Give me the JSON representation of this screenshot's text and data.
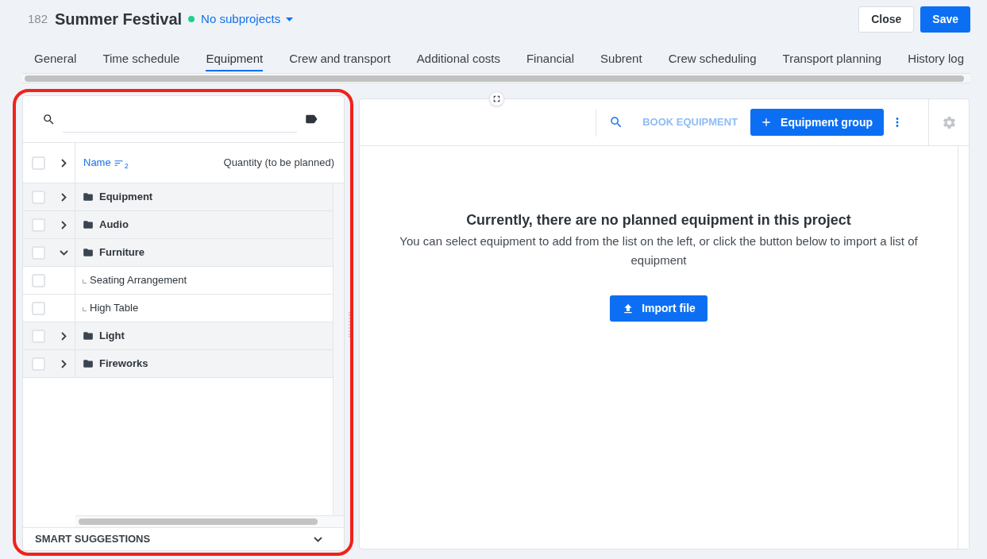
{
  "header": {
    "project_number": "182",
    "title": "Summer Festival",
    "subprojects": "No subprojects",
    "buttons": [
      {
        "label": "Close",
        "kind": "secondary"
      },
      {
        "label": "Save",
        "kind": "primary"
      }
    ]
  },
  "tabs": [
    {
      "label": "General",
      "selected": false
    },
    {
      "label": "Time schedule",
      "selected": false
    },
    {
      "label": "Equipment",
      "selected": true
    },
    {
      "label": "Crew and transport",
      "selected": false
    },
    {
      "label": "Additional costs",
      "selected": false
    },
    {
      "label": "Financial",
      "selected": false
    },
    {
      "label": "Subrent",
      "selected": false
    },
    {
      "label": "Crew scheduling",
      "selected": false
    },
    {
      "label": "Transport planning",
      "selected": false
    },
    {
      "label": "History log",
      "selected": false
    }
  ],
  "equipment_list": {
    "select_all": {
      "checked": false
    },
    "expand_all": {
      "expanded": false
    },
    "columns": [
      {
        "label": "Name",
        "sorted": true,
        "sort_order": "2"
      },
      {
        "label": "Quantity (to be planned)",
        "sorted": false
      }
    ],
    "rows": [
      {
        "kind": "group",
        "name": "Equipment",
        "checked": false,
        "expanded": false
      },
      {
        "kind": "group",
        "name": "Audio",
        "checked": false,
        "expanded": false
      },
      {
        "kind": "group",
        "name": "Furniture",
        "checked": false,
        "expanded": true,
        "children": [
          {
            "kind": "item",
            "name": "Seating Arrangement",
            "checked": false
          },
          {
            "kind": "item",
            "name": "High Table",
            "checked": false
          }
        ]
      },
      {
        "kind": "group",
        "name": "Light",
        "checked": false,
        "expanded": false
      },
      {
        "kind": "group",
        "name": "Fireworks",
        "checked": false,
        "expanded": false
      }
    ],
    "footer": {
      "label": "SMART SUGGESTIONS",
      "expanded": false
    }
  },
  "planned_equipment": {
    "toolbar": {
      "book": {
        "label": "BOOK EQUIPMENT",
        "disabled": true
      },
      "add_button": "Equipment group"
    },
    "empty_state": {
      "title": "Currently, there are no planned equipment in this project",
      "message": "You can select equipment to add from the list on the left, or click the button below to import a list of equipment",
      "button": "Import file"
    }
  }
}
